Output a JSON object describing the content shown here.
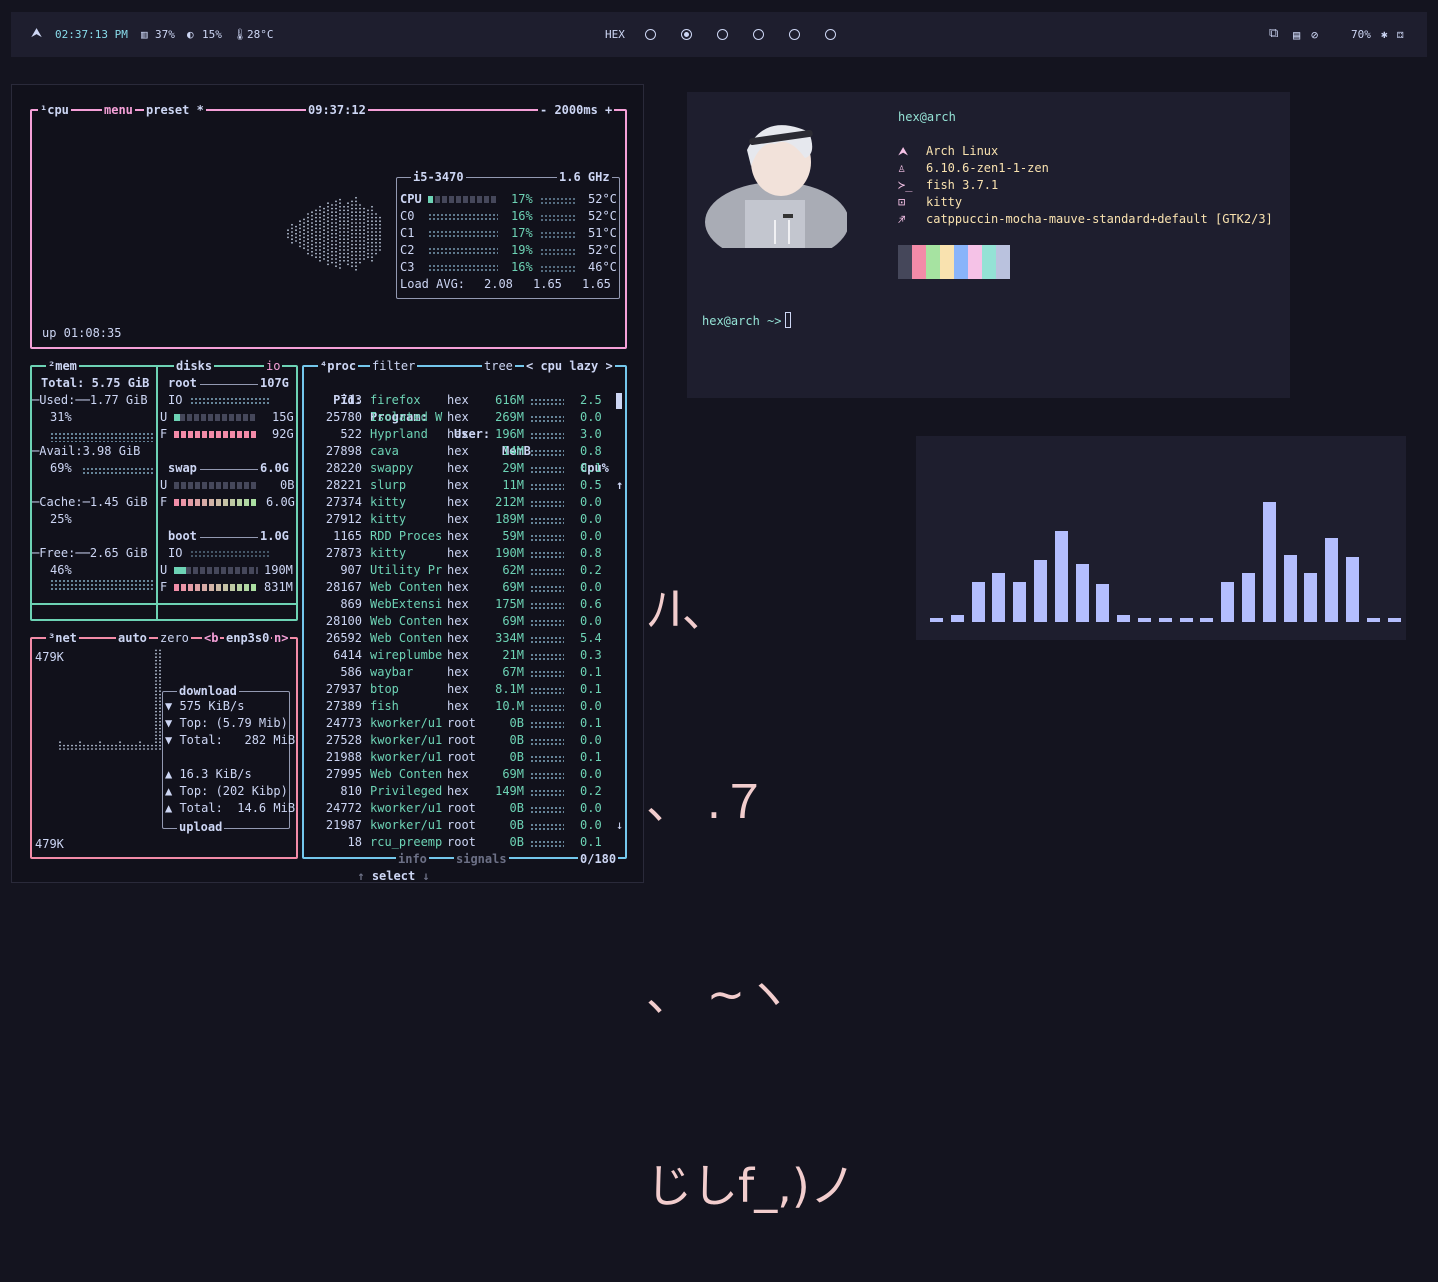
{
  "topbar": {
    "time": "02:37:13 PM",
    "memory": "37%",
    "cpu": "15%",
    "temp": "28°C",
    "workspace_label": "HEX",
    "workspaces": [
      {
        "active": false
      },
      {
        "active": true
      },
      {
        "active": false
      },
      {
        "active": false
      },
      {
        "active": false
      },
      {
        "active": false
      }
    ],
    "volume": "70%",
    "colors": {
      "accent": "#89dceb",
      "text": "#cdd6f4"
    }
  },
  "btop": {
    "cpu": {
      "title_num": "¹",
      "title": "cpu",
      "menu": "menu",
      "preset": "preset *",
      "clock": "09:37:12",
      "interval": "- 2000ms +",
      "uptime": "up 01:08:35",
      "model": "i5-3470",
      "freq": "1.6 GHz",
      "cores": [
        {
          "name": "CPU",
          "pct": "17%",
          "temp": "52°C"
        },
        {
          "name": "C0",
          "pct": "16%",
          "temp": "52°C"
        },
        {
          "name": "C1",
          "pct": "17%",
          "temp": "51°C"
        },
        {
          "name": "C2",
          "pct": "19%",
          "temp": "52°C"
        },
        {
          "name": "C3",
          "pct": "16%",
          "temp": "46°C"
        }
      ],
      "load_label": "Load AVG:",
      "load": [
        "2.08",
        "1.65",
        "1.65"
      ]
    },
    "mem": {
      "title_num": "²",
      "title": "mem",
      "total_label": "Total:",
      "total": "5.75 GiB",
      "used_label": "Used:",
      "used": "1.77 GiB",
      "used_pct": "31%",
      "avail_label": "Avail:",
      "avail": "3.98 GiB",
      "avail_pct": "69%",
      "cache_label": "Cache:",
      "cache": "1.45 GiB",
      "cache_pct": "25%",
      "free_label": "Free:",
      "free": "2.65 GiB",
      "free_pct": "46%"
    },
    "disks": {
      "title": "disks",
      "io": "io",
      "root": {
        "name": "root",
        "size": "107G",
        "io": "IO",
        "used": "15G",
        "free": "92G"
      },
      "swap": {
        "name": "swap",
        "size": "6.0G",
        "used": "0B",
        "free": "6.0G"
      },
      "boot": {
        "name": "boot",
        "size": "1.0G",
        "io": "IO",
        "used": "190M",
        "free": "831M"
      }
    },
    "net": {
      "title_num": "³",
      "title": "net",
      "auto": "auto",
      "zero": "zero",
      "iface_prev": "<b",
      "iface": "enp3s0",
      "iface_next": "n>",
      "scale_top": "479K",
      "scale_bottom": "479K",
      "download_label": "download",
      "download_rate": "575 KiB/s",
      "download_top": "Top: (5.79 Mib)",
      "download_total": "Total:   282 MiB",
      "upload_rate": "16.3 KiB/s",
      "upload_top": "Top: (202 Kibp)",
      "upload_total": "Total:  14.6 MiB",
      "upload_label": "upload"
    },
    "proc": {
      "title_num": "⁴",
      "title": "proc",
      "filter": "filter",
      "tree": "tree",
      "sort": "< cpu lazy >",
      "headers": [
        "Pid:",
        "Program:",
        "User:",
        "MemB",
        "Cpu%"
      ],
      "rows": [
        [
          "713",
          "firefox",
          "hex",
          "616M",
          "2.5"
        ],
        [
          "25780",
          "Isolated W",
          "hex",
          "269M",
          "0.0"
        ],
        [
          "522",
          "Hyprland",
          "hex",
          "196M",
          "3.0"
        ],
        [
          "27898",
          "cava",
          "hex",
          "14M",
          "0.8"
        ],
        [
          "28220",
          "swappy",
          "hex",
          "29M",
          "0.1"
        ],
        [
          "28221",
          "slurp",
          "hex",
          "11M",
          "0.5"
        ],
        [
          "27374",
          "kitty",
          "hex",
          "212M",
          "0.0"
        ],
        [
          "27912",
          "kitty",
          "hex",
          "189M",
          "0.0"
        ],
        [
          "1165",
          "RDD Proces",
          "hex",
          "59M",
          "0.0"
        ],
        [
          "27873",
          "kitty",
          "hex",
          "190M",
          "0.8"
        ],
        [
          "907",
          "Utility Pr",
          "hex",
          "62M",
          "0.2"
        ],
        [
          "28167",
          "Web Conten",
          "hex",
          "69M",
          "0.0"
        ],
        [
          "869",
          "WebExtensi",
          "hex",
          "175M",
          "0.6"
        ],
        [
          "28100",
          "Web Conten",
          "hex",
          "69M",
          "0.0"
        ],
        [
          "26592",
          "Web Conten",
          "hex",
          "334M",
          "5.4"
        ],
        [
          "6414",
          "wireplumbe",
          "hex",
          "21M",
          "0.3"
        ],
        [
          "586",
          "waybar",
          "hex",
          "67M",
          "0.1"
        ],
        [
          "27937",
          "btop",
          "hex",
          "8.1M",
          "0.1"
        ],
        [
          "27389",
          "fish",
          "hex",
          "10.M",
          "0.0"
        ],
        [
          "24773",
          "kworker/u1",
          "root",
          "0B",
          "0.1"
        ],
        [
          "27528",
          "kworker/u1",
          "root",
          "0B",
          "0.0"
        ],
        [
          "21988",
          "kworker/u1",
          "root",
          "0B",
          "0.1"
        ],
        [
          "27995",
          "Web Conten",
          "hex",
          "69M",
          "0.0"
        ],
        [
          "810",
          "Privileged",
          "hex",
          "149M",
          "0.2"
        ],
        [
          "24772",
          "kworker/u1",
          "root",
          "0B",
          "0.0"
        ],
        [
          "21987",
          "kworker/u1",
          "root",
          "0B",
          "0.0"
        ],
        [
          "18",
          "rcu_preemp",
          "root",
          "0B",
          "0.1"
        ]
      ],
      "select": "select",
      "info": "info",
      "signals": "signals",
      "count": "0/180"
    }
  },
  "fetch": {
    "userhost": "hex@arch",
    "os": "Arch Linux",
    "kernel": "6.10.6-zen1-1-zen",
    "shell": "fish 3.7.1",
    "terminal": "kitty",
    "theme": "catppuccin-mocha-mauve-standard+default [GTK2/3]",
    "palette": [
      "#45475a",
      "#f38ba8",
      "#a6e3a1",
      "#f9e2af",
      "#89b4fa",
      "#f5c2e7",
      "#94e2d5",
      "#bac2de"
    ],
    "prompt": "hex@arch ~>"
  },
  "kaomoji": {
    "line1": "ﾉl、",
    "line2": "、 .７",
    "line3": "、 ~ヽ",
    "line4": "じしf_,)ノ"
  },
  "cava": {
    "bars": [
      0.02,
      0.04,
      0.22,
      0.27,
      0.22,
      0.34,
      0.5,
      0.32,
      0.21,
      0.04,
      0.02,
      0.02,
      0.02,
      0.02,
      0.22,
      0.27,
      0.66,
      0.37,
      0.27,
      0.46,
      0.36,
      0.02,
      0.02
    ],
    "color": "#b4befe"
  }
}
